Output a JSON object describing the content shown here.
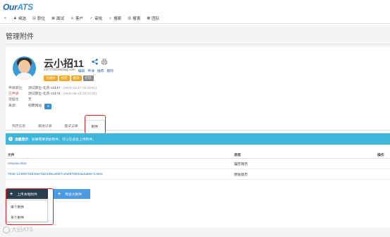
{
  "app": {
    "logo_main": "Our",
    "logo_accent": "ATS"
  },
  "nav": [
    {
      "icon": "menu-icon",
      "glyph": "≡",
      "label": ""
    },
    {
      "icon": "people-icon",
      "glyph": "♟",
      "label": "候选"
    },
    {
      "icon": "briefcase-icon",
      "glyph": "▤",
      "label": "职位"
    },
    {
      "icon": "calendar-icon",
      "glyph": "▦",
      "label": "面试"
    },
    {
      "icon": "user-icon",
      "glyph": "♙",
      "label": "客户"
    },
    {
      "icon": "check-icon",
      "glyph": "✓",
      "label": "审批"
    },
    {
      "icon": "search-icon",
      "glyph": "⌕",
      "label": "搜索"
    },
    {
      "icon": "chart-icon",
      "glyph": "▥",
      "label": "报表"
    },
    {
      "icon": "team-icon",
      "glyph": "▩",
      "label": "团队"
    }
  ],
  "page_title": "管理附件",
  "candidate": {
    "name": "云小招11",
    "email": "237778446@qq.com",
    "actions": [
      "编辑",
      "申请",
      "推荐",
      "删除"
    ],
    "tags": [
      "沟通中",
      "待定",
      "推荐",
      "打印"
    ],
    "info": [
      {
        "label": "申请职位:",
        "value": "测试职位-北京-02147",
        "date": "(2019-12-17 15:19:51)",
        "extra": ""
      },
      {
        "label": "已申请:",
        "value": "测试职位-北京-02176",
        "date": "(2020-05-13 18:10:26)",
        "extra": ""
      },
      {
        "label": "现居住:",
        "value": "无",
        "date": "",
        "extra": ""
      },
      {
        "label": "来源:",
        "value": "招聘网站",
        "date": "",
        "extra": ""
      }
    ]
  },
  "tabs": [
    {
      "label": "简历信息",
      "active": false
    },
    {
      "label": "跟进记录",
      "active": false
    },
    {
      "label": "面试记录",
      "active": false
    },
    {
      "label": "附件",
      "active": true
    }
  ],
  "tip": {
    "title": "温馨提示:",
    "text": "如果需要添加附件，可以在此处上传附件。"
  },
  "table": {
    "headers": [
      "文件",
      "类型",
      "操作"
    ],
    "rows": [
      {
        "file": "resume.html",
        "type": "履历简历"
      },
      {
        "file": "7046-14365725549a73a2139ca93f7cefef979533ada58e-0.html",
        "type": "原始简历"
      }
    ]
  },
  "buttons": {
    "upload": "上传本地附件",
    "bigfile": "传送大附件"
  },
  "dropdown": [
    "单个附件",
    "多个附件"
  ],
  "watermark": "大招ATS"
}
